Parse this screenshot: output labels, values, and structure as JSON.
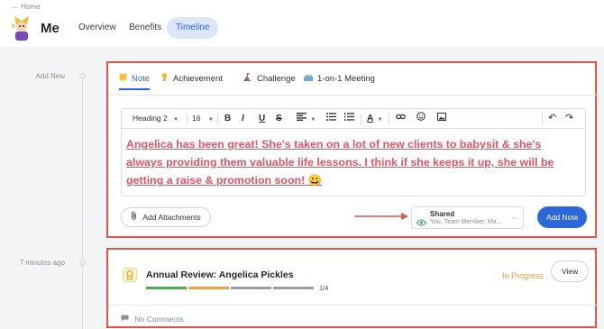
{
  "header": {
    "home_link": "← Home",
    "title": "Me",
    "tabs": [
      {
        "label": "Overview"
      },
      {
        "label": "Benefits"
      },
      {
        "label": "Timeline",
        "active": true
      }
    ]
  },
  "timeline": {
    "add_new_label": "Add New",
    "entry_time": "7 minutes ago"
  },
  "composer": {
    "tabs": [
      {
        "label": "Note",
        "icon": "note-icon",
        "active": true
      },
      {
        "label": "Achievement",
        "icon": "trophy-icon"
      },
      {
        "label": "Challenge",
        "icon": "mountain-flag-icon"
      },
      {
        "label": "1-on-1 Meeting",
        "icon": "meeting-icon"
      }
    ],
    "toolbar": {
      "heading": "Heading 2",
      "size": "16",
      "bold": "B",
      "italic": "I",
      "underline": "U",
      "strike": "S"
    },
    "body_text": "Angelica has been great! She's taken on a lot of new clients to babysit & she's always providing them valuable life lessons. I think if she keeps it up, she will be getting a raise & promotion soon! 😀",
    "attach_label": "Add Attachments",
    "share": {
      "title": "Shared",
      "subtitle": "You, Team Member, Ma..."
    },
    "submit_label": "Add Note"
  },
  "review_card": {
    "title": "Annual Review: Angelica Pickles",
    "progress_text": "1/4",
    "progress_fraction": 0.25,
    "status": "In Progress",
    "view_label": "View",
    "comments_label": "No Comments"
  },
  "colors": {
    "accent": "#2d67d9",
    "highlight_border": "#e05646",
    "note_text": "#e05668",
    "status": "#e0a23a",
    "progress_green": "#4caf50",
    "progress_orange": "#f0a33a",
    "progress_gray": "#9a9ea6"
  }
}
